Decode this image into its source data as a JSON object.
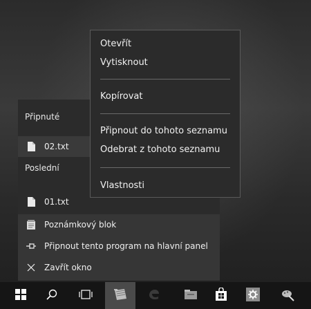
{
  "jumplist": {
    "pinned_heading": "Připnuté",
    "pinned_items": [
      {
        "label": "02.txt",
        "icon": "text-file-icon"
      }
    ],
    "recent_heading": "Poslední",
    "recent_items": [
      {
        "label": "01.txt",
        "icon": "text-file-icon"
      }
    ],
    "tasks": [
      {
        "label": "Poznámkový blok",
        "icon": "notepad-icon"
      },
      {
        "label": "Připnout tento program na hlavní panel",
        "icon": "pin-icon"
      },
      {
        "label": "Zavřít okno",
        "icon": "close-icon"
      }
    ]
  },
  "context_menu": {
    "items": [
      {
        "label": "Otevřít"
      },
      {
        "label": "Vytisknout"
      },
      {
        "label": "Kopírovat"
      },
      {
        "label": "Připnout do tohoto seznamu"
      },
      {
        "label": "Odebrat z tohoto seznamu"
      },
      {
        "label": "Vlastnosti"
      }
    ]
  },
  "taskbar": {
    "buttons": [
      {
        "icon": "windows-start-icon"
      },
      {
        "icon": "search-icon"
      },
      {
        "icon": "task-view-icon"
      },
      {
        "icon": "notepad-icon",
        "active": true
      },
      {
        "icon": "edge-icon"
      },
      {
        "icon": "file-explorer-icon"
      },
      {
        "icon": "store-icon"
      },
      {
        "icon": "settings-icon"
      },
      {
        "icon": "paint-icon"
      }
    ]
  }
}
